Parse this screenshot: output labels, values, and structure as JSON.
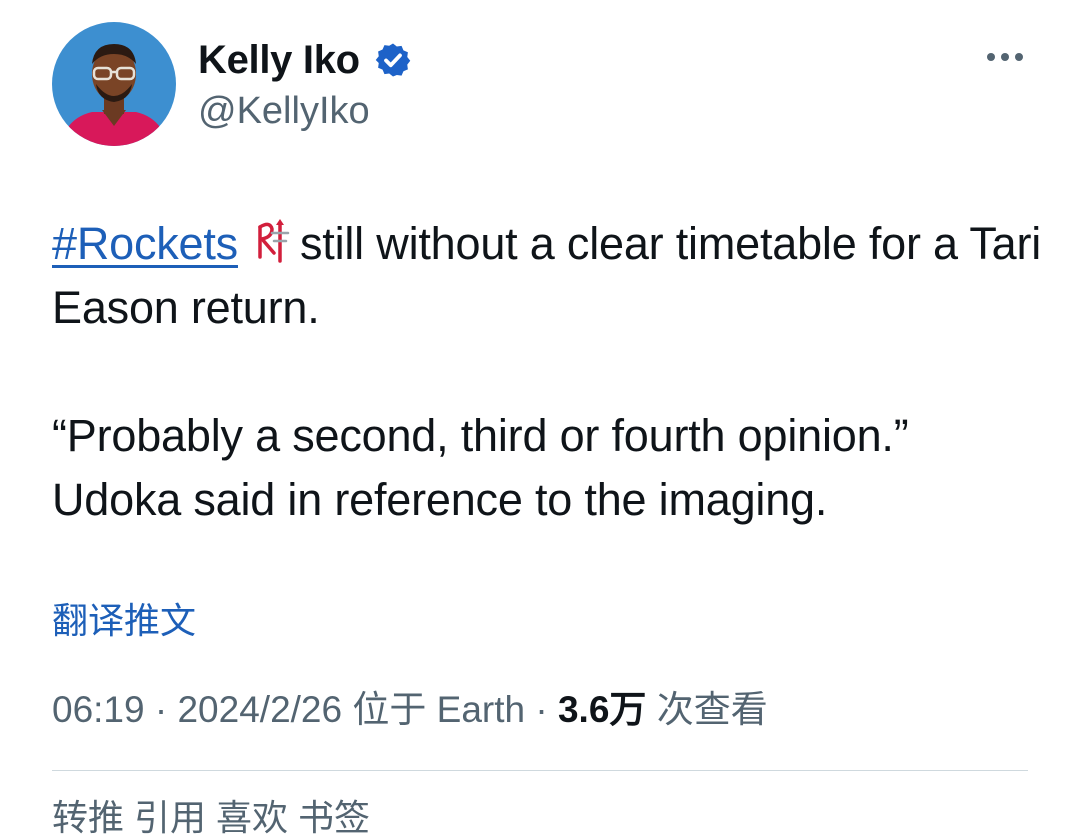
{
  "author": {
    "display_name": "Kelly Iko",
    "handle": "@KellyIko",
    "verified": true,
    "avatar_icon": "avatar-photo"
  },
  "more_icon": "more-horizontal-icon",
  "tweet": {
    "hashtag": "#Rockets",
    "emoji_icon": "rockets-logo-icon",
    "line1_rest": "still without a clear timetable for a Tari Eason return.",
    "quote": "“Probably a second, third or fourth opinion.” Udoka said in reference to the imaging."
  },
  "translate_label": "翻译推文",
  "meta": {
    "time": "06:19",
    "separator": " · ",
    "date": "2024/2/26",
    "location": "位于 Earth",
    "views_count": "3.6万",
    "views_label": "次查看"
  },
  "stats_partial": "转推       引用       喜欢       书签",
  "colors": {
    "link": "#1d5fb8",
    "text": "#0f1419",
    "secondary": "#536471",
    "verified": "#1d62c8",
    "avatar_bg": "#3d8fd0",
    "shirt": "#d8185a"
  }
}
